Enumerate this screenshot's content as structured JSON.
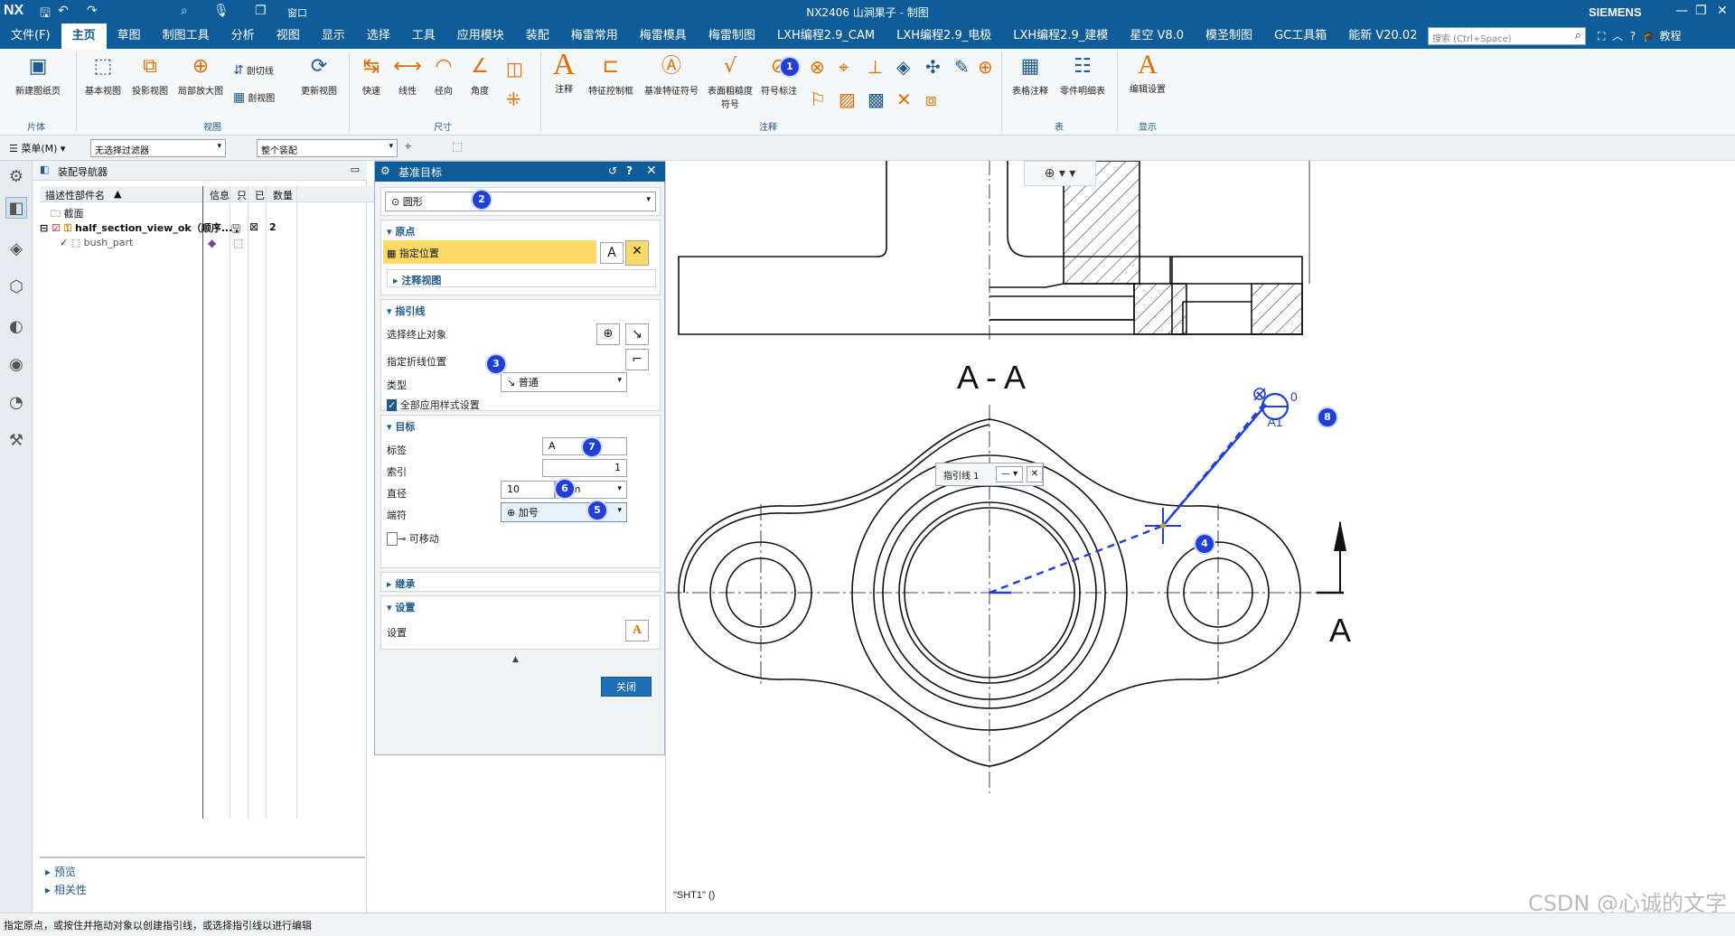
{
  "titlebar": {
    "app": "NX",
    "window_title": "NX2406 山涧果子 - 制图",
    "brand": "SIEMENS",
    "window_menu": "窗口"
  },
  "menubar": {
    "items": [
      "文件(F)",
      "主页",
      "草图",
      "制图工具",
      "分析",
      "视图",
      "显示",
      "选择",
      "工具",
      "应用模块",
      "装配",
      "梅雷常用",
      "梅雷模具",
      "梅雷制图",
      "LXH编程2.9_CAM",
      "LXH编程2.9_电极",
      "LXH编程2.9_建模",
      "星空 V8.0",
      "模圣制图",
      "GC工具箱",
      "能新 V20.02"
    ],
    "active": "主页",
    "search_placeholder": "搜索 (Ctrl+Space)",
    "tutorial": "教程"
  },
  "ribbon": {
    "new_sheet": "新建图纸页",
    "base_view": "基本视图",
    "projected_view": "投影视图",
    "detail_view": "局部放大图",
    "section_line": "剖切线",
    "section_view": "剖视图",
    "update_view": "更新视图",
    "quick": "快速",
    "linear": "线性",
    "radial": "径向",
    "angular": "角度",
    "note": "注释",
    "fcf": "特征控制框",
    "datum_feature": "基准特征符号",
    "surface_finish": "表面粗糙度符号",
    "symbol_note": "符号标注",
    "table_note": "表格注释",
    "parts_list": "零件明细表",
    "edit_settings": "编辑设置",
    "sec_sheet": "片体",
    "sec_view": "视图",
    "sec_dim": "尺寸",
    "sec_annotation": "注释",
    "sec_table": "表",
    "sec_display": "显示"
  },
  "toolbar2": {
    "menu": "菜单(M)",
    "filter": "无选择过滤器",
    "scope": "整个装配"
  },
  "navigator": {
    "title": "装配导航器",
    "col_name": "描述性部件名",
    "col_info": "信息",
    "col_readonly": "只",
    "col_modified": "已",
    "col_count": "数量",
    "rows": [
      {
        "name": "截面"
      },
      {
        "name": "half_section_view_ok（顺序...",
        "count": "2"
      },
      {
        "name": "bush_part"
      }
    ],
    "preview": "预览",
    "dependencies": "相关性"
  },
  "dialog": {
    "title": "基准目标",
    "type_value": "圆形",
    "origin_header": "原点",
    "specify_location": "指定位置",
    "annotation_view": "注释视图",
    "leader_header": "指引线",
    "select_terminating": "选择终止对象",
    "specify_jog": "指定折线位置",
    "type_label": "类型",
    "leader_type": "普通",
    "apply_all_styles": "全部应用样式设置",
    "target_header": "目标",
    "label_label": "标签",
    "label_value": "A",
    "index_label": "索引",
    "index_value": "1",
    "diameter_label": "直径",
    "diameter_value": "10",
    "unit": "mm",
    "terminator_label": "端符",
    "terminator_value": "加号",
    "movable": "可移动",
    "inherit_header": "继承",
    "settings_header": "设置",
    "settings_label": "设置",
    "close": "关闭"
  },
  "badges": [
    "1",
    "2",
    "3",
    "4",
    "5",
    "6",
    "7",
    "8"
  ],
  "drawing": {
    "section_label": "A - A",
    "arrow_label": "A",
    "leader_popup": "指引线 1",
    "datum_top": "0",
    "datum_bottom": "A1",
    "sheet_name": "\"SHT1\"  ()",
    "watermark": "CSDN @心诚的文字"
  },
  "status": "指定原点，或按住并拖动对象以创建指引线，或选择指引线以进行编辑",
  "colors": {
    "brand_blue": "#0e5c9a",
    "highlight": "#ffd966",
    "leader_blue": "#1e3fe0",
    "badge": "#1f3fd6"
  }
}
